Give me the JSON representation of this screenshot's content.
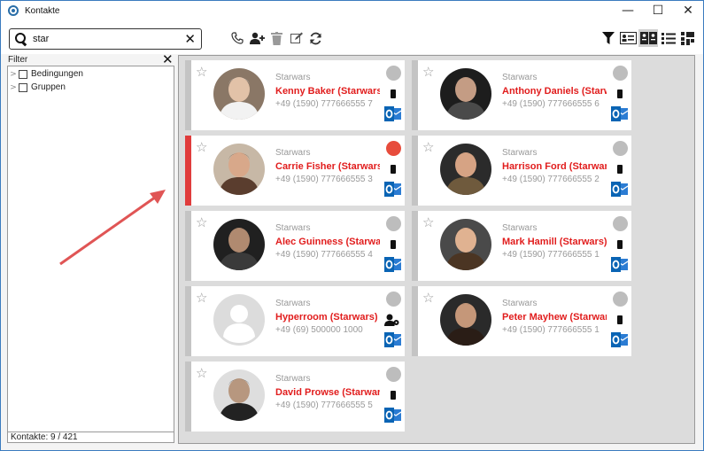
{
  "window": {
    "title": "Kontakte",
    "minimize": "—",
    "maximize": "☐",
    "close": "✕"
  },
  "search": {
    "value": "star",
    "clear": "✕"
  },
  "filter": {
    "title": "Filter",
    "close": "✕",
    "items": [
      {
        "label": "Bedingungen"
      },
      {
        "label": "Gruppen"
      }
    ]
  },
  "status": {
    "count_text": "Kontakte: 9 / 421"
  },
  "contacts": [
    {
      "company": "Starwars",
      "name": "Kenny Baker (Starwars)",
      "phone": "+49 (1590) 777666555 7",
      "status": "gray",
      "device": "mobile-icon",
      "avatar": "photo",
      "active": false
    },
    {
      "company": "Starwars",
      "name": "Anthony Daniels (Starwars)",
      "phone": "+49 (1590) 777666555 6",
      "status": "gray",
      "device": "mobile-icon",
      "avatar": "photo",
      "active": false
    },
    {
      "company": "Starwars",
      "name": "Carrie Fisher (Starwars)",
      "phone": "+49 (1590) 777666555 3",
      "status": "red",
      "device": "mobile-icon",
      "avatar": "photo",
      "active": true
    },
    {
      "company": "Starwars",
      "name": "Harrison Ford (Starwars)",
      "phone": "+49 (1590) 777666555 2",
      "status": "gray",
      "device": "mobile-icon",
      "avatar": "photo",
      "active": false
    },
    {
      "company": "Starwars",
      "name": "Alec Guinness (Starwars)",
      "phone": "+49 (1590) 777666555 4",
      "status": "gray",
      "device": "mobile-icon",
      "avatar": "photo",
      "active": false
    },
    {
      "company": "Starwars",
      "name": "Mark Hamill (Starwars)",
      "phone": "+49 (1590) 777666555 1",
      "status": "gray",
      "device": "mobile-icon",
      "avatar": "photo",
      "active": false
    },
    {
      "company": "Starwars",
      "name": " Hyperroom (Starwars)",
      "phone": "+49 (69) 500000 1000",
      "status": "gray",
      "device": "user-settings-icon",
      "avatar": "placeholder",
      "active": false
    },
    {
      "company": "Starwars",
      "name": "Peter Mayhew (Starwars)",
      "phone": "+49 (1590) 777666555 1",
      "status": "gray",
      "device": "mobile-icon",
      "avatar": "photo",
      "active": false
    },
    {
      "company": "Starwars",
      "name": "David Prowse (Starwars)",
      "phone": "+49 (1590) 777666555 5",
      "status": "gray",
      "device": "mobile-icon",
      "avatar": "photo",
      "active": false
    }
  ],
  "colors": {
    "accent_red": "#e11d1d",
    "status_gray": "#bdbdbd",
    "status_red": "#e74c3c",
    "annotation_arrow": "#e05555",
    "outlook_blue": "#0a64b4"
  }
}
